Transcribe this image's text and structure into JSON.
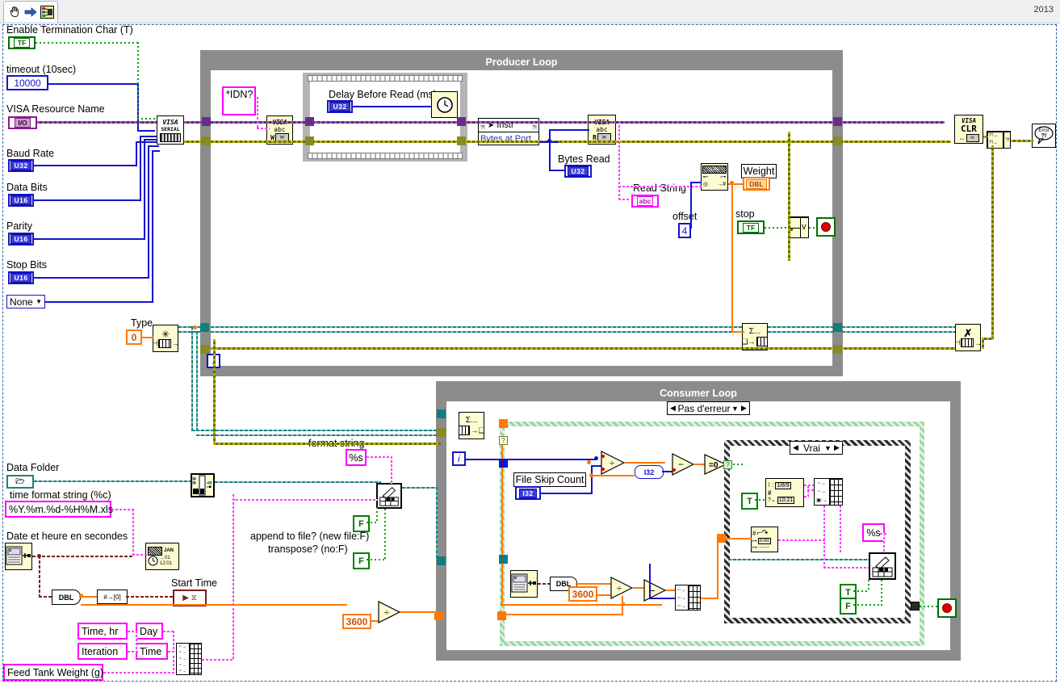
{
  "window": {
    "year_label": "2013",
    "toolbar": {
      "hand_tool_icon": "hand-tool-icon",
      "arrow_icon": "right-arrow-icon",
      "diagram_icon": "block-diagram-icon"
    }
  },
  "controls": {
    "enable_term_char": {
      "label": "Enable Termination Char (T)",
      "value": "TF"
    },
    "timeout": {
      "label": "timeout (10sec)",
      "value": "10000"
    },
    "visa_resource": {
      "label": "VISA Resource Name",
      "value": "I/O"
    },
    "baud_rate": {
      "label": "Baud Rate",
      "value": "U32"
    },
    "data_bits": {
      "label": "Data Bits",
      "value": "U16"
    },
    "parity": {
      "label": "Parity",
      "value": "U16"
    },
    "stop_bits": {
      "label": "Stop Bits",
      "value": "U16"
    },
    "flow_control": {
      "value": "None"
    },
    "type": {
      "label": "Type",
      "value": "0"
    }
  },
  "producer": {
    "title": "Producer Loop",
    "idn_constant": "*IDN?",
    "visa_serial": {
      "line1": "VISA",
      "line2": "SERIAL"
    },
    "visa_write": {
      "line1": "VISA",
      "line2": "abc",
      "line3": "W"
    },
    "visa_read": {
      "line1": "VISA",
      "line2": "abc",
      "line3": "R"
    },
    "visa_clear": {
      "line1": "VISA",
      "line2": "CLR"
    },
    "delay_before_read": {
      "label": "Delay Before Read (ms)",
      "value": "U32"
    },
    "bytes_at_port": {
      "label_top": "Instr",
      "label_bottom": "Bytes at Port"
    },
    "bytes_read": {
      "label": "Bytes Read",
      "value": "U32"
    },
    "read_string": {
      "label": "Read String",
      "value": "abc"
    },
    "offset": {
      "label": "offset",
      "value": "4"
    },
    "scan_node": "n.nn",
    "weight": {
      "label": "Weight",
      "value": "DBL"
    },
    "stop": {
      "label": "stop",
      "value": "TF"
    },
    "or_gate": "v",
    "stop_button": "stop-button",
    "error_handler": {
      "line1": "Error",
      "line2": "?!"
    },
    "obtain_queue": "obtain-queue",
    "enqueue": "enqueue-element",
    "release_queue": "release-queue",
    "iteration": "i"
  },
  "consumer": {
    "title": "Consumer Loop",
    "case_selector": "Pas d'erreur",
    "inner_case_selector": "Vrai",
    "dequeue": "dequeue-element",
    "iteration": "i",
    "file_skip_count": {
      "label": "File Skip Count",
      "value": "I32"
    },
    "i32_coerce": "I32",
    "eq_zero": "=0",
    "divide": "÷",
    "subtract": "-",
    "seconds_const": "3600",
    "date_time_format_1": "1/8/9",
    "date_time_format_2": "10:21",
    "true_const": "T",
    "false_const": "F",
    "format_pct_s": "%s",
    "stop_button": "stop-button"
  },
  "file_section": {
    "data_folder": {
      "label": "Data Folder"
    },
    "time_format_string": {
      "label": "time format string (%c)",
      "value": "%Y.%m.%d-%H%M.xls"
    },
    "date_time_seconds": {
      "label": "Date et heure en secondes"
    },
    "dbl_conv": "DBL",
    "num_to_str": "#→[0]",
    "start_time": {
      "label": "Start Time"
    },
    "format_string": {
      "label": "format string",
      "value": "%s"
    },
    "append_to_file": {
      "label": "append to file? (new file:F)",
      "value": "F"
    },
    "transpose": {
      "label": "transpose? (no:F)",
      "value": "F"
    },
    "seconds_const": "3600",
    "headers": {
      "time_hr": "Time, hr",
      "iteration": "Iteration",
      "day": "Day",
      "time": "Time",
      "feed_tank_weight": "Feed Tank Weight (g)"
    }
  },
  "colors": {
    "loop_grey": "#8c8c8c",
    "node_yellow": "#fdfbd0",
    "wire_yellow": "#8a8a1e",
    "wire_purple": "#6b2d8c",
    "wire_magenta": "#ff00ff",
    "wire_orange": "#ff7800",
    "wire_blue": "#1414c8",
    "wire_teal": "#1f8080",
    "case_green": "#9ad6a0"
  }
}
